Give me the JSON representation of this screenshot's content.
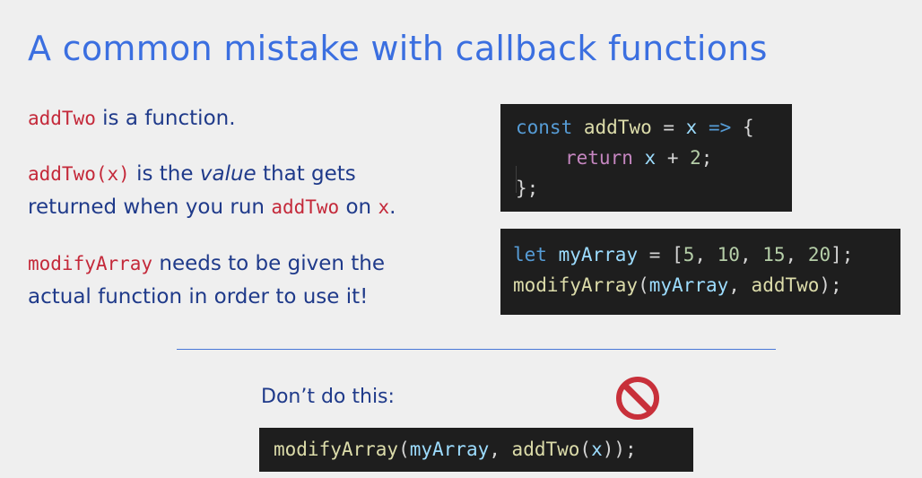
{
  "slide": {
    "title": "A common mistake with callback functions"
  },
  "explanation": {
    "p1": {
      "code": "addTwo",
      "text": " is a function."
    },
    "p2": {
      "code1": "addTwo(x)",
      "text1": " is the ",
      "emphasis": "value",
      "text2": " that gets",
      "text3": "returned when you run ",
      "code2": "addTwo",
      "text4": " on ",
      "code3": "x",
      "text5": "."
    },
    "p3": {
      "code": "modifyArray",
      "text1": " needs to be given the",
      "text2": "actual function in order to use it!"
    }
  },
  "code_block_1": {
    "line1": {
      "kw": "const",
      "name": "addTwo",
      "eq": " = ",
      "param": "x",
      "arrow": "=>",
      "brace": "{"
    },
    "line2": {
      "kw": "return",
      "var": "x",
      "op": " + ",
      "num": "2",
      "end": ";"
    },
    "line3": "};"
  },
  "code_block_2": {
    "line1": {
      "kw": "let",
      "name": "myArray",
      "eq": " = ",
      "open": "[",
      "n1": "5",
      "n2": "10",
      "n3": "15",
      "n4": "20",
      "sep": ", ",
      "close": "];"
    },
    "line2": {
      "fn": "modifyArray",
      "open": "(",
      "arg1": "myArray",
      "sep": ", ",
      "arg2": "addTwo",
      "close": ");"
    }
  },
  "warning": {
    "label": "Don’t do this:",
    "icon": "no-entry-icon",
    "icon_color": "#c8303a",
    "code": {
      "fn": "modifyArray",
      "open": "(",
      "arg1": "myArray",
      "sep": ", ",
      "fn2": "addTwo",
      "open2": "(",
      "arg2": "x",
      "close": "));"
    }
  },
  "colors": {
    "title": "#3b6fe0",
    "body_text": "#1f3a8a",
    "inline_code": "#c4293a",
    "code_bg": "#1e1e1e",
    "keyword": "#569cd6",
    "control_keyword": "#c586c0",
    "function": "#dcdcaa",
    "variable": "#9cdcfe",
    "number": "#b5cea8",
    "divider": "#4a78d8"
  }
}
